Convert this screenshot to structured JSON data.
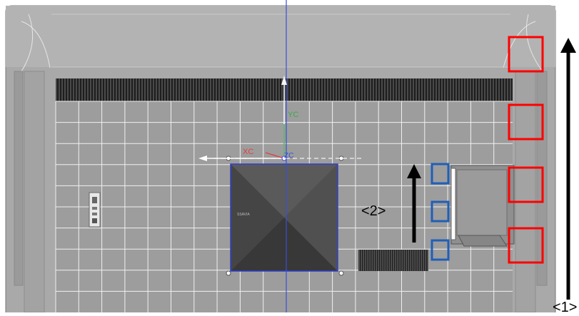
{
  "viewport": {
    "tv_logo_text": "SSAVIA"
  },
  "axes": {
    "x_label": "XC",
    "y_label": "YC",
    "z_label": "ZC",
    "x_color": "#e04040",
    "y_color": "#3aa84a",
    "z_color": "#3a4fd8"
  },
  "annotations": {
    "label_1": "<1>",
    "label_2": "<2>",
    "red_box_color": "#ff0000",
    "blue_box_color": "#1f5fb8",
    "arrow_color": "#000000"
  },
  "selection": {
    "color": "#2f3fcf",
    "handle_count": 4
  }
}
